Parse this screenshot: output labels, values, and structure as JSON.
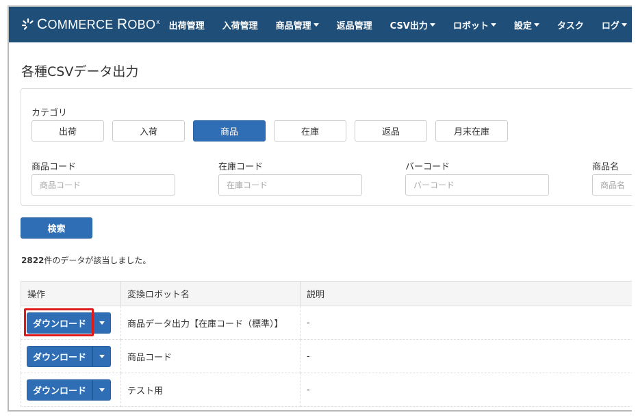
{
  "navbar": {
    "brand": {
      "part1_big": "C",
      "part1_rest": "OMMERCE",
      "part2_big": "R",
      "part2_rest": "OBO",
      "mark": "x",
      "icon": "sparkle-logo-icon"
    },
    "items": [
      {
        "label": "出荷管理",
        "dropdown": false
      },
      {
        "label": "入荷管理",
        "dropdown": false
      },
      {
        "label": "商品管理",
        "dropdown": true
      },
      {
        "label": "返品管理",
        "dropdown": false
      },
      {
        "label": "CSV出力",
        "dropdown": true
      },
      {
        "label": "ロボット",
        "dropdown": true
      },
      {
        "label": "設定",
        "dropdown": true
      },
      {
        "label": "タスク",
        "dropdown": false
      },
      {
        "label": "ログ",
        "dropdown": true
      }
    ]
  },
  "page": {
    "title": "各種CSVデータ出力"
  },
  "filters": {
    "category_label": "カテゴリ",
    "categories": [
      {
        "label": "出荷",
        "active": false
      },
      {
        "label": "入荷",
        "active": false
      },
      {
        "label": "商品",
        "active": true
      },
      {
        "label": "在庫",
        "active": false
      },
      {
        "label": "返品",
        "active": false
      },
      {
        "label": "月末在庫",
        "active": false
      }
    ],
    "fields": [
      {
        "label": "商品コード",
        "placeholder": "商品コード",
        "value": ""
      },
      {
        "label": "在庫コード",
        "placeholder": "在庫コード",
        "value": ""
      },
      {
        "label": "バーコード",
        "placeholder": "バーコード",
        "value": ""
      },
      {
        "label": "商品名",
        "placeholder": "商品名",
        "value": ""
      }
    ],
    "search_label": "検索"
  },
  "results": {
    "count": "2822",
    "count_suffix": "件のデータが該当しました。"
  },
  "table": {
    "headers": [
      "操作",
      "変換ロボット名",
      "説明"
    ],
    "download_label": "ダウンロード",
    "rows": [
      {
        "robot_name": "商品データ出力【在庫コード（標準）】",
        "description": "-",
        "highlighted": true
      },
      {
        "robot_name": "商品コード",
        "description": "-",
        "highlighted": false
      },
      {
        "robot_name": "テスト用",
        "description": "-",
        "highlighted": false
      }
    ]
  },
  "colors": {
    "navbar": "#1f4e79",
    "primary": "#2f6eb5",
    "highlight": "#e01a1a"
  }
}
